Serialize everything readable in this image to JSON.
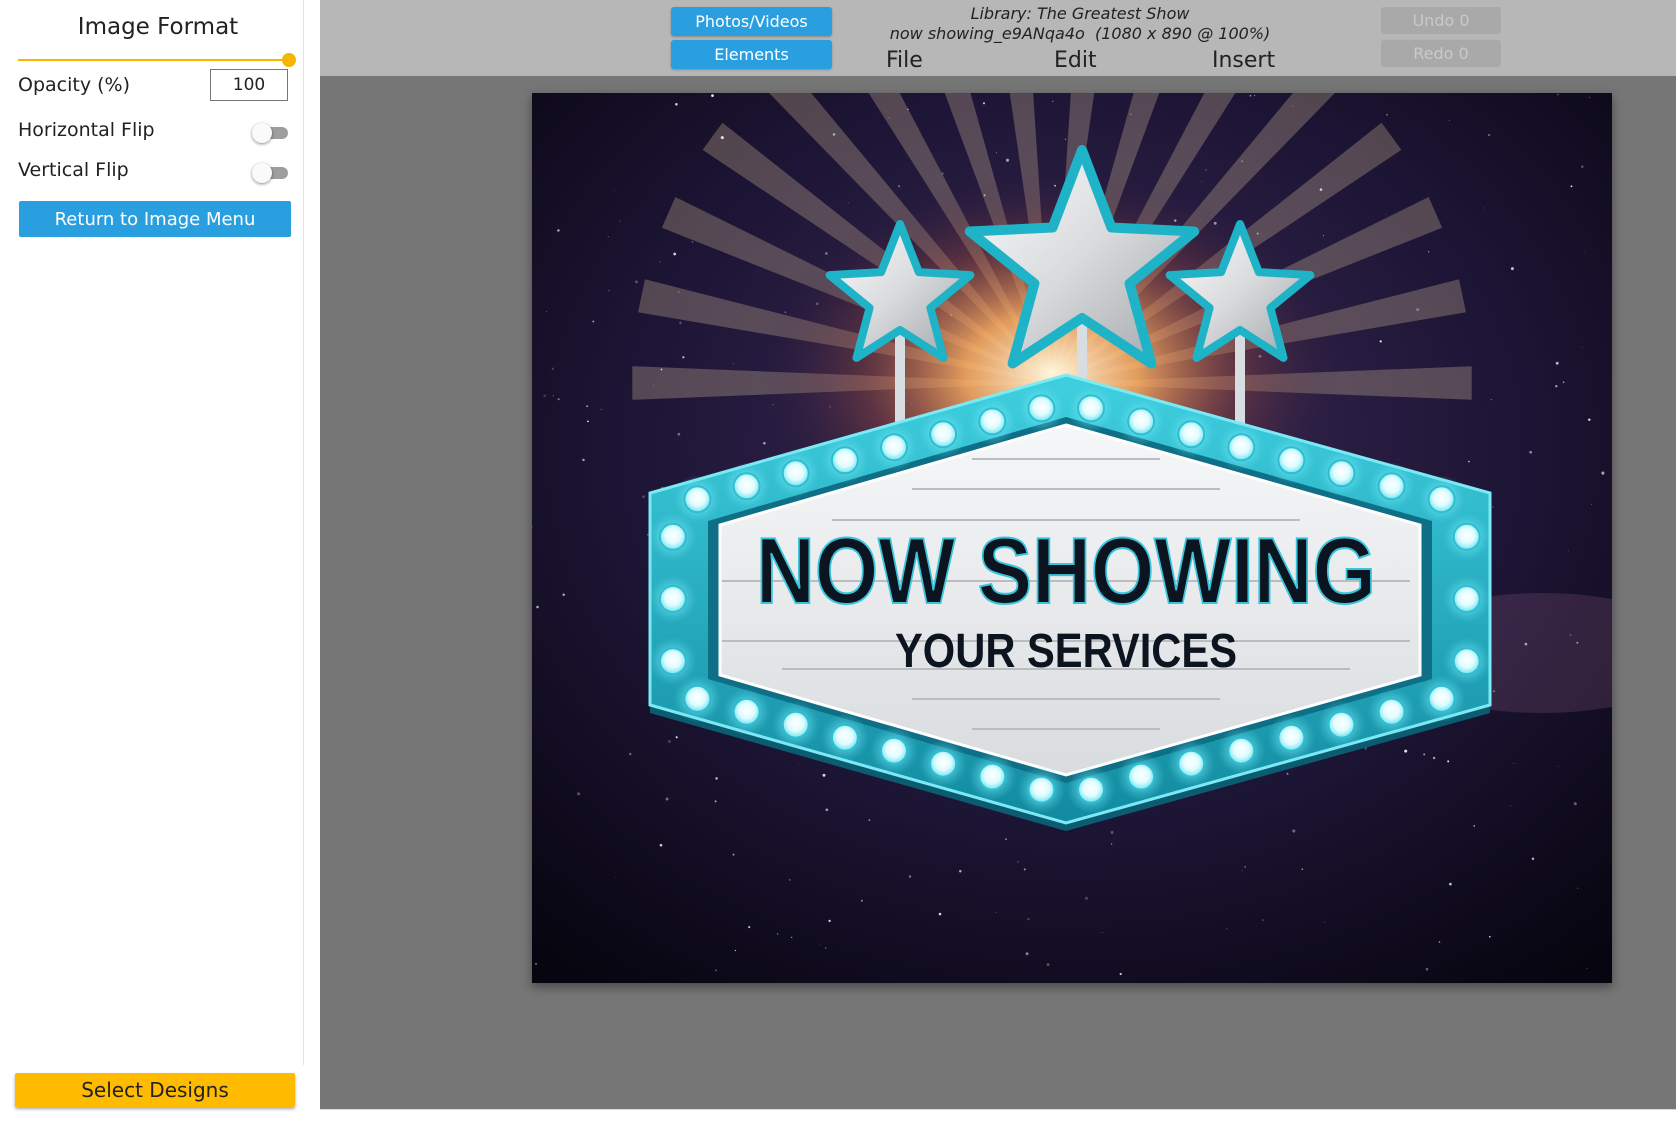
{
  "sidebar": {
    "title": "Image Format",
    "opacity": {
      "label": "Opacity (%)",
      "value": "100",
      "fraction": 1.0
    },
    "horizontal_flip": {
      "label": "Horizontal Flip",
      "on": false
    },
    "vertical_flip": {
      "label": "Vertical Flip",
      "on": false
    },
    "return_button": "Return to Image Menu",
    "select_designs_button": "Select Designs"
  },
  "toolbar": {
    "photos_videos": "Photos/Videos",
    "elements": "Elements",
    "library_line": "Library: The Greatest Show",
    "file_line": "now showing_e9ANqa4o  (1080 x 890 @ 100%)",
    "menu": {
      "file": "File",
      "edit": "Edit",
      "insert": "Insert"
    },
    "undo": "Undo 0",
    "redo": "Redo 0"
  },
  "canvas": {
    "headline": "NOW SHOWING",
    "subline": "YOUR SERVICES"
  },
  "colors": {
    "accent_blue": "#2a9fe0",
    "accent_yellow": "#ffbb00",
    "sign_teal": "#1fb3c8",
    "workspace_gray": "#767676",
    "topbar_gray": "#b7b7b7"
  },
  "icons": {
    "toggle": "switch-toggle",
    "slider": "range-slider"
  }
}
